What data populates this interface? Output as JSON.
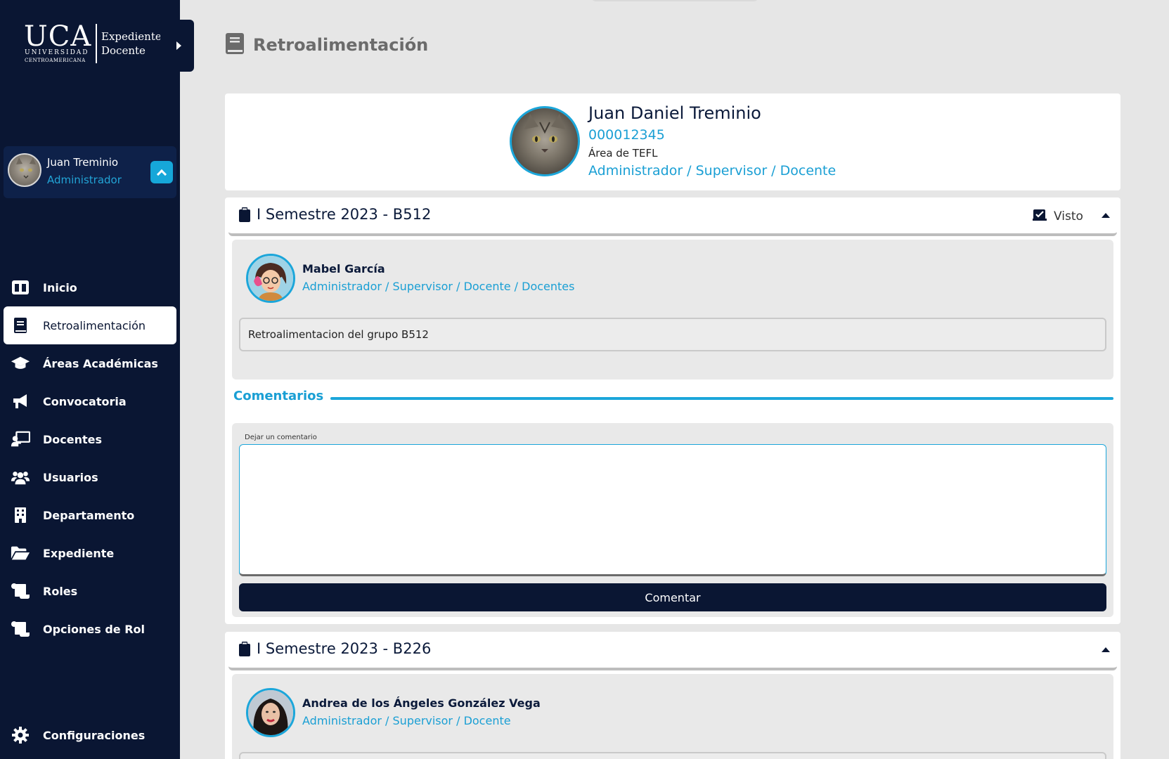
{
  "brand": {
    "logo_main": "UCA",
    "logo_line1": "UNIVERSIDAD",
    "logo_line2": "CENTROAMERICANA",
    "product_line1": "Expediente",
    "product_line2": "Docente"
  },
  "sidebar_user": {
    "name": "Juan Treminio",
    "role": "Administrador"
  },
  "nav": {
    "items": [
      {
        "label": "Inicio",
        "icon": "columns-icon"
      },
      {
        "label": "Retroalimentación",
        "icon": "book-icon",
        "active": true
      },
      {
        "label": "Áreas Académicas",
        "icon": "graduation-cap-icon"
      },
      {
        "label": "Convocatoria",
        "icon": "megaphone-icon"
      },
      {
        "label": "Docentes",
        "icon": "chalkboard-teacher-icon"
      },
      {
        "label": "Usuarios",
        "icon": "users-icon"
      },
      {
        "label": "Departamento",
        "icon": "building-icon"
      },
      {
        "label": "Expediente",
        "icon": "folder-open-icon"
      },
      {
        "label": "Roles",
        "icon": "scroll-icon"
      },
      {
        "label": "Opciones de Rol",
        "icon": "scroll-icon"
      }
    ],
    "settings_label": "Configuraciones"
  },
  "page": {
    "title": "Retroalimentación"
  },
  "profile": {
    "name": "Juan Daniel Treminio",
    "id": "000012345",
    "area": "Área de TEFL",
    "roles": "Administrador / Supervisor / Docente"
  },
  "sections": [
    {
      "title": "I Semestre 2023 - B512",
      "seen_label": "Visto",
      "author_name": "Mabel García",
      "author_roles": "Administrador / Supervisor / Docente / Docentes",
      "feedback_text": "Retroalimentacion del grupo B512",
      "comments_heading": "Comentarios",
      "comment_label": "Dejar un comentario",
      "comment_value": "",
      "comment_button": "Comentar"
    },
    {
      "title": "I Semestre 2023 - B226",
      "author_name": "Andrea de los Ángeles González Vega",
      "author_roles": "Administrador / Supervisor / Docente"
    }
  ],
  "colors": {
    "sidebar_bg": "#0a1633",
    "accent": "#1ba6da",
    "page_bg": "#e6e6e6"
  }
}
